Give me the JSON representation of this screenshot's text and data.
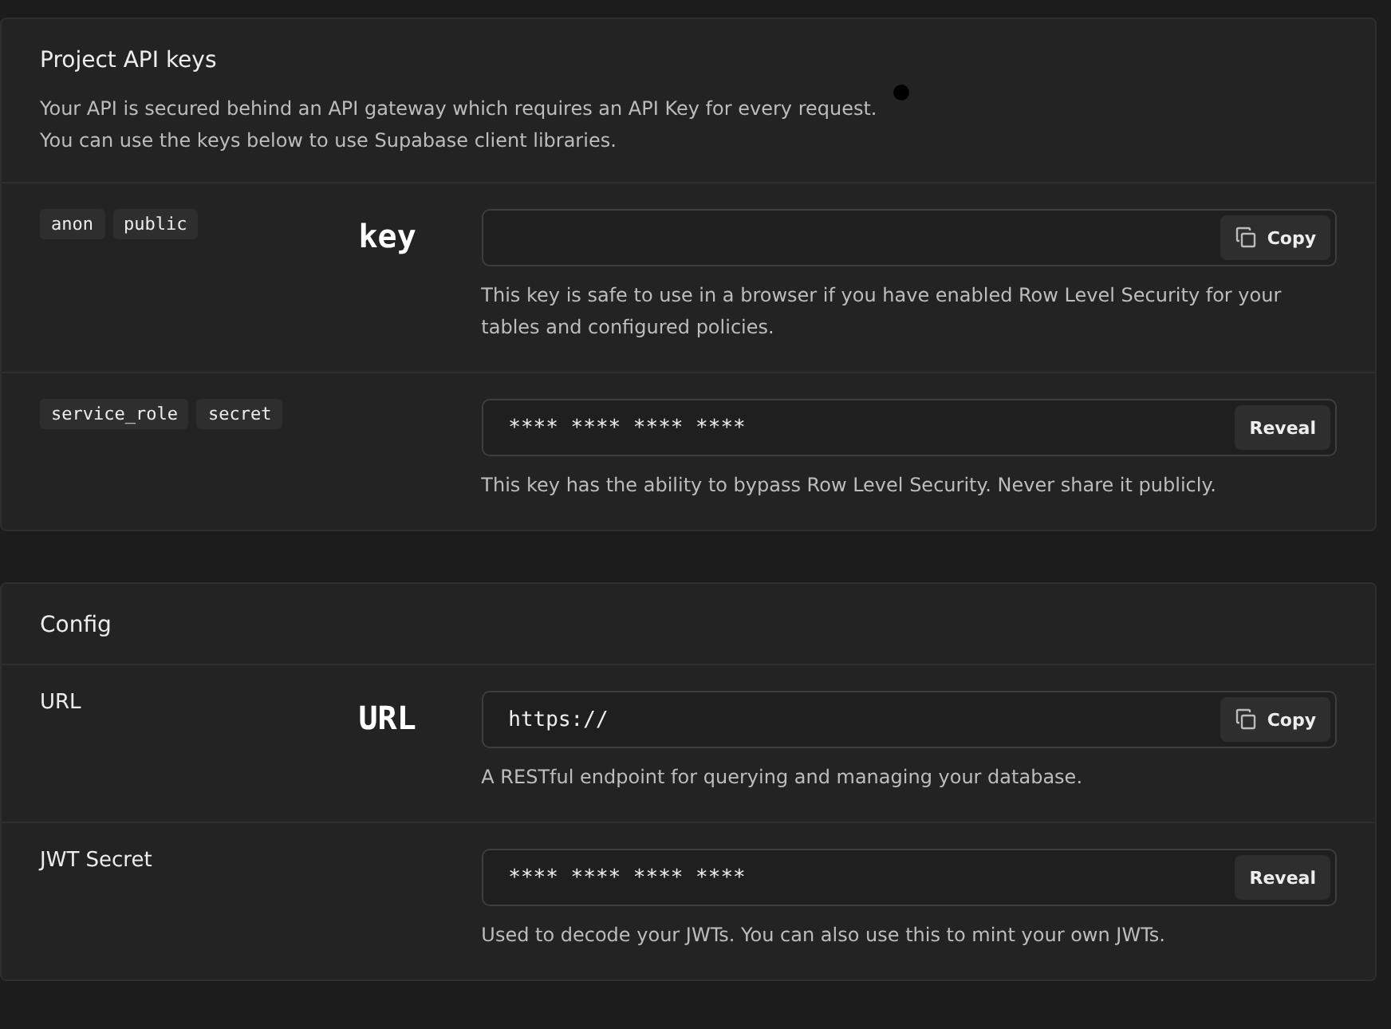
{
  "cards": [
    {
      "title": "Project API keys",
      "description": [
        "Your API is secured behind an API gateway which requires an API Key for every request.",
        "You can use the keys below to use Supabase client libraries."
      ],
      "rows": [
        {
          "tags": [
            "anon",
            "public"
          ],
          "annotation": "key",
          "value": "",
          "button": {
            "kind": "copy",
            "label": "Copy"
          },
          "help": "This key is safe to use in a browser if you have enabled Row Level Security for your tables and configured policies."
        },
        {
          "tags": [
            "service_role",
            "secret"
          ],
          "value": "**** **** **** ****",
          "button": {
            "kind": "reveal",
            "label": "Reveal"
          },
          "help": "This key has the ability to bypass Row Level Security. Never share it publicly."
        }
      ]
    },
    {
      "title": "Config",
      "rows": [
        {
          "label": "URL",
          "annotation": "URL",
          "value": "https://",
          "button": {
            "kind": "copy",
            "label": "Copy"
          },
          "help": "A RESTful endpoint for querying and managing your database."
        },
        {
          "label": "JWT Secret",
          "value": "**** **** **** ****",
          "button": {
            "kind": "reveal",
            "label": "Reveal"
          },
          "help": "Used to decode your JWTs. You can also use this to mint your own JWTs."
        }
      ]
    }
  ]
}
